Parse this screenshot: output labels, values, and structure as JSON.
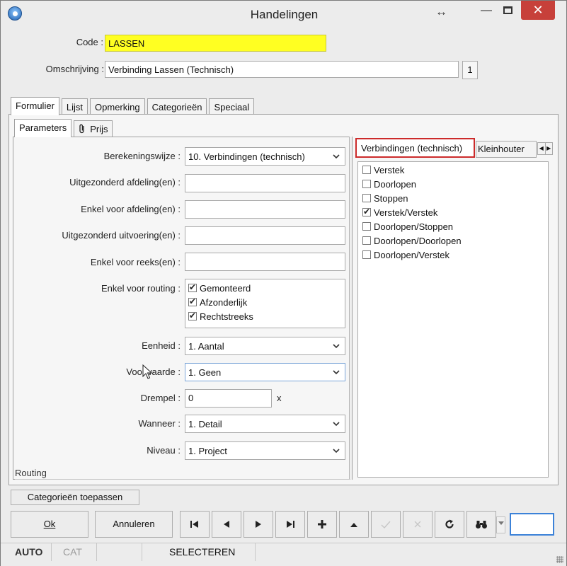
{
  "window": {
    "title": "Handelingen",
    "resize_indicator": "↔",
    "minimize": "—",
    "close": "✕"
  },
  "header": {
    "code_label": "Code :",
    "code_value": "LASSEN",
    "description_label": "Omschrijving :",
    "description_value": "Verbinding Lassen (Technisch)",
    "counter": "1"
  },
  "main_tabs": [
    {
      "label": "Formulier",
      "active": true
    },
    {
      "label": "Lijst"
    },
    {
      "label": "Opmerking"
    },
    {
      "label": "Categorieën"
    },
    {
      "label": "Speciaal"
    }
  ],
  "sub_tabs": [
    {
      "label": "Parameters",
      "active": true
    },
    {
      "label": "Prijs",
      "icon": "paperclip-icon"
    }
  ],
  "form": {
    "berekeningswijze": {
      "label": "Berekeningswijze :",
      "value": "10. Verbindingen (technisch)"
    },
    "uitgezonderd_afdeling": {
      "label": "Uitgezonderd afdeling(en) :",
      "value": ""
    },
    "enkel_afdeling": {
      "label": "Enkel voor afdeling(en) :",
      "value": ""
    },
    "uitgezonderd_uitvoering": {
      "label": "Uitgezonderd uitvoering(en) :",
      "value": ""
    },
    "enkel_reeks": {
      "label": "Enkel voor reeks(en) :",
      "value": ""
    },
    "routing": {
      "label": "Enkel voor routing :",
      "options": [
        {
          "label": "Gemonteerd",
          "checked": true
        },
        {
          "label": "Afzonderlijk",
          "checked": true
        },
        {
          "label": "Rechtstreeks",
          "checked": true
        }
      ]
    },
    "eenheid": {
      "label": "Eenheid :",
      "value": "1. Aantal"
    },
    "voorwaarde": {
      "label": "Voorwaarde :",
      "value": "1. Geen"
    },
    "drempel": {
      "label": "Drempel :",
      "value": "0",
      "suffix": "x"
    },
    "wanneer": {
      "label": "Wanneer :",
      "value": "1. Detail"
    },
    "niveau": {
      "label": "Niveau :",
      "value": "1. Project"
    },
    "routing_group_label": "Routing"
  },
  "right_panel": {
    "tabs": [
      {
        "label": "Verbindingen (technisch)",
        "active": true
      },
      {
        "label": "Kleinhouter"
      }
    ],
    "items": [
      {
        "label": "Verstek",
        "checked": false
      },
      {
        "label": "Doorlopen",
        "checked": false
      },
      {
        "label": "Stoppen",
        "checked": false
      },
      {
        "label": "Verstek/Verstek",
        "checked": true
      },
      {
        "label": "Doorlopen/Stoppen",
        "checked": false
      },
      {
        "label": "Doorlopen/Doorlopen",
        "checked": false
      },
      {
        "label": "Doorlopen/Verstek",
        "checked": false
      }
    ]
  },
  "actions": {
    "apply_categories": "Categorieën toepassen",
    "ok": "Ok",
    "cancel": "Annuleren"
  },
  "statusbar": {
    "mode": "AUTO",
    "cat": "CAT",
    "action": "SELECTEREN"
  },
  "colors": {
    "code_highlight": "#ffff22",
    "active_tab_outline": "#cc2b2b",
    "close_button": "#c7403a",
    "focus": "#3c82d8"
  }
}
